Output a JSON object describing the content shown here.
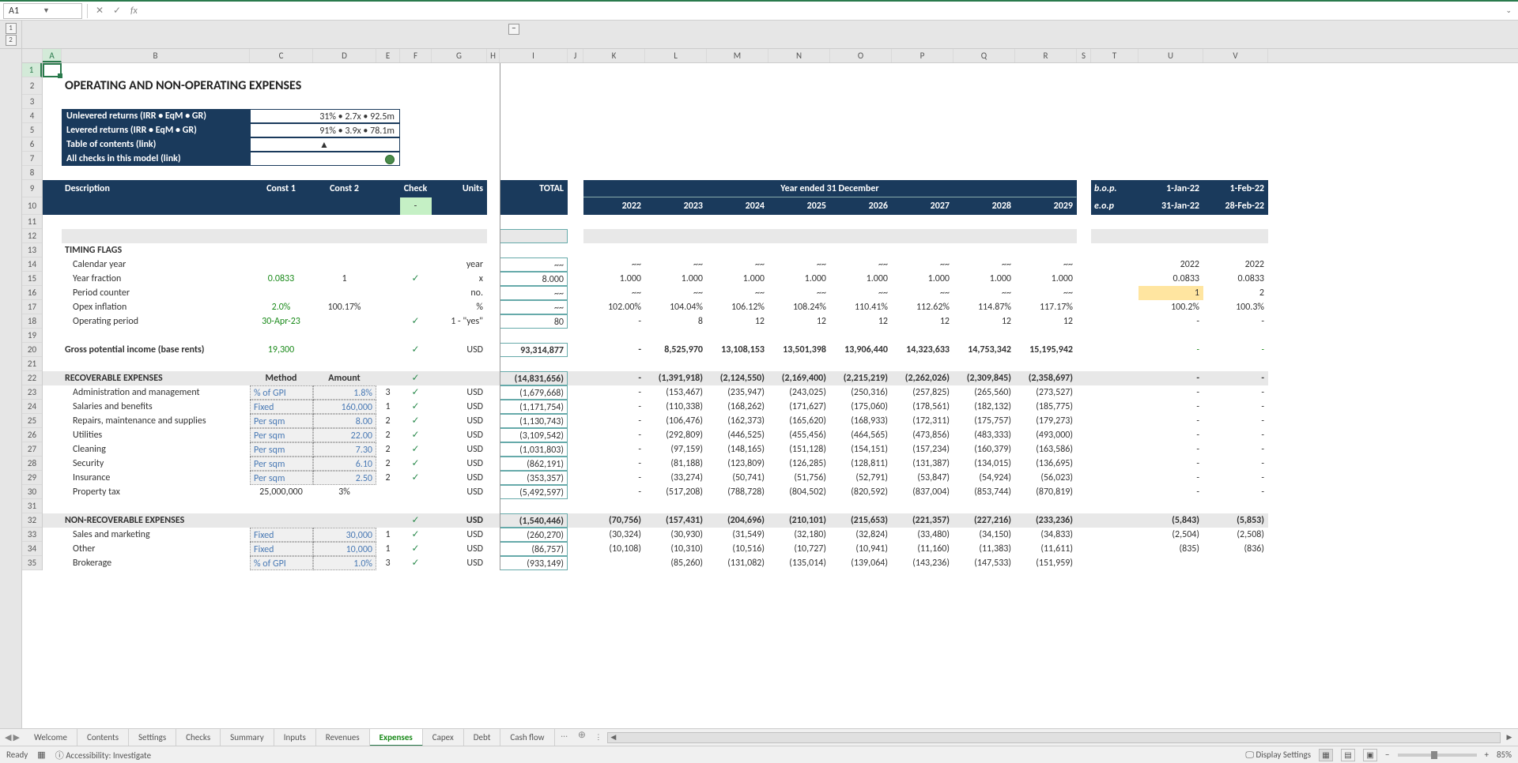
{
  "activeCell": "A1",
  "title": "OPERATING AND NON-OPERATING EXPENSES",
  "info": {
    "unlevered_lbl": "Unlevered returns (IRR • EqM • GR)",
    "unlevered_val": "31% • 2.7x • 92.5m",
    "levered_lbl": "Levered returns (IRR • EqM • GR)",
    "levered_val": "91% • 3.9x • 78.1m",
    "toc_lbl": "Table of contents (link)",
    "toc_val": "▲",
    "checks_lbl": "All checks in this model (link)"
  },
  "headers": {
    "desc": "Description",
    "const1": "Const 1",
    "const2": "Const 2",
    "check": "Check",
    "units": "Units",
    "total": "TOTAL",
    "year_span": "Year ended 31 December",
    "years": [
      "2022",
      "2023",
      "2024",
      "2025",
      "2026",
      "2027",
      "2028",
      "2029"
    ],
    "bop": "b.o.p.",
    "eop": "e.o.p",
    "bop_vals": [
      "1-Jan-22",
      "1-Feb-22"
    ],
    "eop_vals": [
      "31-Jan-22",
      "28-Feb-22"
    ],
    "check_dash": "-"
  },
  "cols": [
    "A",
    "B",
    "C",
    "D",
    "E",
    "F",
    "G",
    "H",
    "I",
    "J",
    "K",
    "L",
    "M",
    "N",
    "O",
    "P",
    "Q",
    "R",
    "S",
    "T",
    "U",
    "V"
  ],
  "rownums": [
    1,
    2,
    3,
    4,
    5,
    6,
    7,
    8,
    9,
    10,
    11,
    12,
    13,
    14,
    15,
    16,
    17,
    18,
    19,
    20,
    21,
    22,
    23,
    24,
    25,
    26,
    27,
    28,
    29,
    30,
    31,
    32,
    33,
    34,
    35
  ],
  "sections": {
    "timing": "TIMING FLAGS",
    "recov": "RECOVERABLE EXPENSES",
    "nonrecov": "NON-RECOVERABLE EXPENSES"
  },
  "rows": {
    "calendar": {
      "lbl": "Calendar year",
      "unit": "year",
      "total": "~~",
      "yrs": [
        "~~",
        "~~",
        "~~",
        "~~",
        "~~",
        "~~",
        "~~",
        "~~"
      ],
      "u": "2022",
      "v": "2022"
    },
    "yearfrac": {
      "lbl": "Year fraction",
      "c1": "0.0833",
      "c2": "1",
      "unit": "x",
      "total": "8.000",
      "yrs": [
        "1.000",
        "1.000",
        "1.000",
        "1.000",
        "1.000",
        "1.000",
        "1.000",
        "1.000"
      ],
      "u": "0.0833",
      "v": "0.0833"
    },
    "periodctr": {
      "lbl": "Period counter",
      "unit": "no.",
      "total": "~~",
      "yrs": [
        "~~",
        "~~",
        "~~",
        "~~",
        "~~",
        "~~",
        "~~",
        "~~"
      ],
      "u": "1",
      "v": "2"
    },
    "opexinfl": {
      "lbl": "Opex inflation",
      "c1": "2.0%",
      "c2": "100.17%",
      "unit": "%",
      "total": "~~",
      "yrs": [
        "102.00%",
        "104.04%",
        "106.12%",
        "108.24%",
        "110.41%",
        "112.62%",
        "114.87%",
        "117.17%"
      ],
      "u": "100.2%",
      "v": "100.3%"
    },
    "opperiod": {
      "lbl": "Operating period",
      "c1": "30-Apr-23",
      "unit": "1 - \"yes\"",
      "total": "80",
      "yrs": [
        "-",
        "8",
        "12",
        "12",
        "12",
        "12",
        "12",
        "12"
      ],
      "u": "-",
      "v": "-"
    },
    "gpi": {
      "lbl": "Gross potential income (base rents)",
      "c1": "19,300",
      "unit": "USD",
      "total": "93,314,877",
      "yrs": [
        "-",
        "8,525,970",
        "13,108,153",
        "13,501,398",
        "13,906,440",
        "14,323,633",
        "14,753,342",
        "15,195,942"
      ],
      "u": "-",
      "v": "-"
    },
    "recov_hdr": {
      "method": "Method",
      "amount": "Amount",
      "total": "(14,831,656)",
      "yrs": [
        "-",
        "(1,391,918)",
        "(2,124,550)",
        "(2,169,400)",
        "(2,215,219)",
        "(2,262,026)",
        "(2,309,845)",
        "(2,358,697)"
      ],
      "u": "-",
      "v": "-"
    },
    "admin": {
      "lbl": "Administration and management",
      "m": "% of GPI",
      "a": "1.8%",
      "e": "3",
      "unit": "USD",
      "total": "(1,679,668)",
      "yrs": [
        "-",
        "(153,467)",
        "(235,947)",
        "(243,025)",
        "(250,316)",
        "(257,825)",
        "(265,560)",
        "(273,527)"
      ],
      "u": "-",
      "v": "-"
    },
    "salaries": {
      "lbl": "Salaries and benefits",
      "m": "Fixed",
      "a": "160,000",
      "e": "1",
      "unit": "USD",
      "total": "(1,171,754)",
      "yrs": [
        "-",
        "(110,338)",
        "(168,262)",
        "(171,627)",
        "(175,060)",
        "(178,561)",
        "(182,132)",
        "(185,775)"
      ],
      "u": "-",
      "v": "-"
    },
    "repairs": {
      "lbl": "Repairs, maintenance and supplies",
      "m": "Per sqm",
      "a": "8.00",
      "e": "2",
      "unit": "USD",
      "total": "(1,130,743)",
      "yrs": [
        "-",
        "(106,476)",
        "(162,373)",
        "(165,620)",
        "(168,933)",
        "(172,311)",
        "(175,757)",
        "(179,273)"
      ],
      "u": "-",
      "v": "-"
    },
    "utilities": {
      "lbl": "Utilities",
      "m": "Per sqm",
      "a": "22.00",
      "e": "2",
      "unit": "USD",
      "total": "(3,109,542)",
      "yrs": [
        "-",
        "(292,809)",
        "(446,525)",
        "(455,456)",
        "(464,565)",
        "(473,856)",
        "(483,333)",
        "(493,000)"
      ],
      "u": "-",
      "v": "-"
    },
    "cleaning": {
      "lbl": "Cleaning",
      "m": "Per sqm",
      "a": "7.30",
      "e": "2",
      "unit": "USD",
      "total": "(1,031,803)",
      "yrs": [
        "-",
        "(97,159)",
        "(148,165)",
        "(151,128)",
        "(154,151)",
        "(157,234)",
        "(160,379)",
        "(163,586)"
      ],
      "u": "-",
      "v": "-"
    },
    "security": {
      "lbl": "Security",
      "m": "Per sqm",
      "a": "6.10",
      "e": "2",
      "unit": "USD",
      "total": "(862,191)",
      "yrs": [
        "-",
        "(81,188)",
        "(123,809)",
        "(126,285)",
        "(128,811)",
        "(131,387)",
        "(134,015)",
        "(136,695)"
      ],
      "u": "-",
      "v": "-"
    },
    "insurance": {
      "lbl": "Insurance",
      "m": "Per sqm",
      "a": "2.50",
      "e": "2",
      "unit": "USD",
      "total": "(353,357)",
      "yrs": [
        "-",
        "(33,274)",
        "(50,741)",
        "(51,756)",
        "(52,791)",
        "(53,847)",
        "(54,924)",
        "(56,023)"
      ],
      "u": "-",
      "v": "-"
    },
    "ptax": {
      "lbl": "Property tax",
      "c1": "25,000,000",
      "c2": "3%",
      "unit": "USD",
      "total": "(5,492,597)",
      "yrs": [
        "-",
        "(517,208)",
        "(788,728)",
        "(804,502)",
        "(820,592)",
        "(837,004)",
        "(853,744)",
        "(870,819)"
      ],
      "u": "-",
      "v": "-"
    },
    "nonrecov_hdr": {
      "unit": "USD",
      "total": "(1,540,446)",
      "yrs": [
        "(70,756)",
        "(157,431)",
        "(204,696)",
        "(210,101)",
        "(215,653)",
        "(221,357)",
        "(227,216)",
        "(233,236)"
      ],
      "u": "(5,843)",
      "v": "(5,853)"
    },
    "sales": {
      "lbl": "Sales and marketing",
      "m": "Fixed",
      "a": "30,000",
      "e": "1",
      "unit": "USD",
      "total": "(260,270)",
      "yrs": [
        "(30,324)",
        "(30,930)",
        "(31,549)",
        "(32,180)",
        "(32,824)",
        "(33,480)",
        "(34,150)",
        "(34,833)"
      ],
      "u": "(2,504)",
      "v": "(2,508)"
    },
    "other": {
      "lbl": "Other",
      "m": "Fixed",
      "a": "10,000",
      "e": "1",
      "unit": "USD",
      "total": "(86,757)",
      "yrs": [
        "(10,108)",
        "(10,310)",
        "(10,516)",
        "(10,727)",
        "(10,941)",
        "(11,160)",
        "(11,383)",
        "(11,611)"
      ],
      "u": "(835)",
      "v": "(836)"
    },
    "brokerage": {
      "lbl": "Brokerage",
      "m": "% of GPI",
      "a": "1.0%",
      "e": "3",
      "unit": "USD",
      "total": "(933,149)",
      "yrs": [
        "",
        "(85,260)",
        "(131,082)",
        "(135,014)",
        "(139,064)",
        "(143,236)",
        "(147,533)",
        "(151,959)"
      ],
      "u": "",
      "v": ""
    }
  },
  "sheetTabs": [
    "Welcome",
    "Contents",
    "Settings",
    "Checks",
    "Summary",
    "Inputs",
    "Revenues",
    "Expenses",
    "Capex",
    "Debt",
    "Cash flow"
  ],
  "activeTab": "Expenses",
  "statusbar": {
    "ready": "Ready",
    "access": "Accessibility: Investigate",
    "display": "Display Settings",
    "zoom": "85%"
  },
  "chart_data": null
}
